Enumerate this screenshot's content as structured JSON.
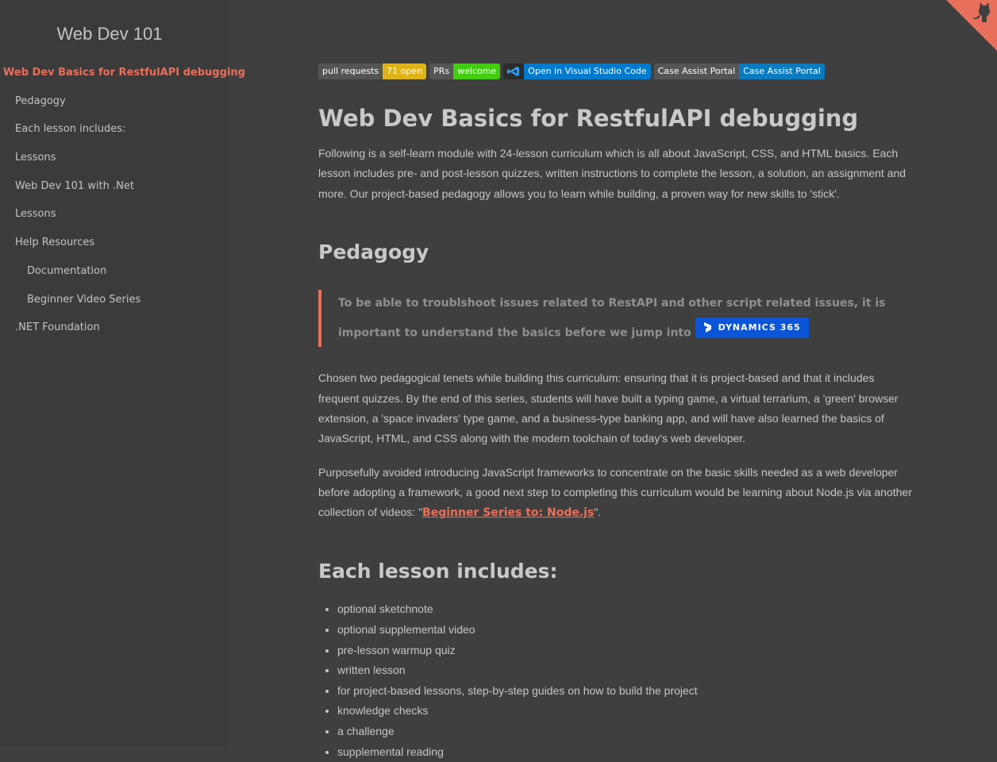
{
  "sidebar": {
    "app_name": "Web Dev 101",
    "items": [
      {
        "label": "Web Dev Basics for RestfulAPI debugging"
      },
      {
        "label": "Pedagogy"
      },
      {
        "label": "Each lesson includes:"
      },
      {
        "label": "Lessons"
      },
      {
        "label": "Web Dev 101 with .Net"
      },
      {
        "label": "Lessons"
      },
      {
        "label": "Help Resources"
      },
      {
        "label": "Documentation"
      },
      {
        "label": "Beginner Video Series"
      },
      {
        "label": ".NET Foundation"
      }
    ]
  },
  "badges": {
    "pull_requests": {
      "label": "pull requests",
      "value": "71 open"
    },
    "prs": {
      "label": "PRs",
      "value": "welcome"
    },
    "vscode": {
      "value": "Open in Visual Studio Code"
    },
    "case_assist": {
      "label": "Case Assist Portal",
      "value": "Case Assist Portal"
    }
  },
  "main": {
    "title": "Web Dev Basics for RestfulAPI debugging",
    "intro": "Following is a self-learn module with 24-lesson curriculum which is all about JavaScript, CSS, and HTML basics. Each lesson includes pre- and post-lesson quizzes, written instructions to complete the lesson, a solution, an assignment and more. Our project-based pedagogy allows you to learn while building, a proven way for new skills to 'stick'.",
    "pedagogy_heading": "Pedagogy",
    "quote": "To be able to troublshoot issues related to RestAPI and other script related issues, it is important to understand the basics before we jump into",
    "dynamics_badge": "DYNAMICS 365",
    "para2": "Chosen two pedagogical tenets while building this curriculum: ensuring that it is project-based and that it includes frequent quizzes. By the end of this series, students will have built a typing game, a virtual terrarium, a 'green' browser extension, a 'space invaders' type game, and a business-type banking app, and will have also learned the basics of JavaScript, HTML, and CSS along with the modern toolchain of today's web developer.",
    "para3_before": "Purposefully avoided introducing JavaScript frameworks to concentrate on the basic skills needed as a web developer before adopting a framework, a good next step to completing this curriculum would be learning about Node.js via another collection of videos: \"",
    "para3_link": "Beginner Series to: Node.js",
    "para3_after": "\".",
    "each_heading": "Each lesson includes:",
    "includes": [
      "optional sketchnote",
      "optional supplemental video",
      "pre-lesson warmup quiz",
      "written lesson",
      "for project-based lessons, step-by-step guides on how to build the project",
      "knowledge checks",
      "a challenge",
      "supplemental reading"
    ]
  },
  "colors": {
    "background": "#3f3f3f",
    "accent": "#e8705a",
    "dynamics_blue": "#0b55d9"
  },
  "icons": {
    "corner": "github-octocat-icon",
    "vscode": "vscode-icon",
    "dynamics": "dynamics-365-icon"
  }
}
